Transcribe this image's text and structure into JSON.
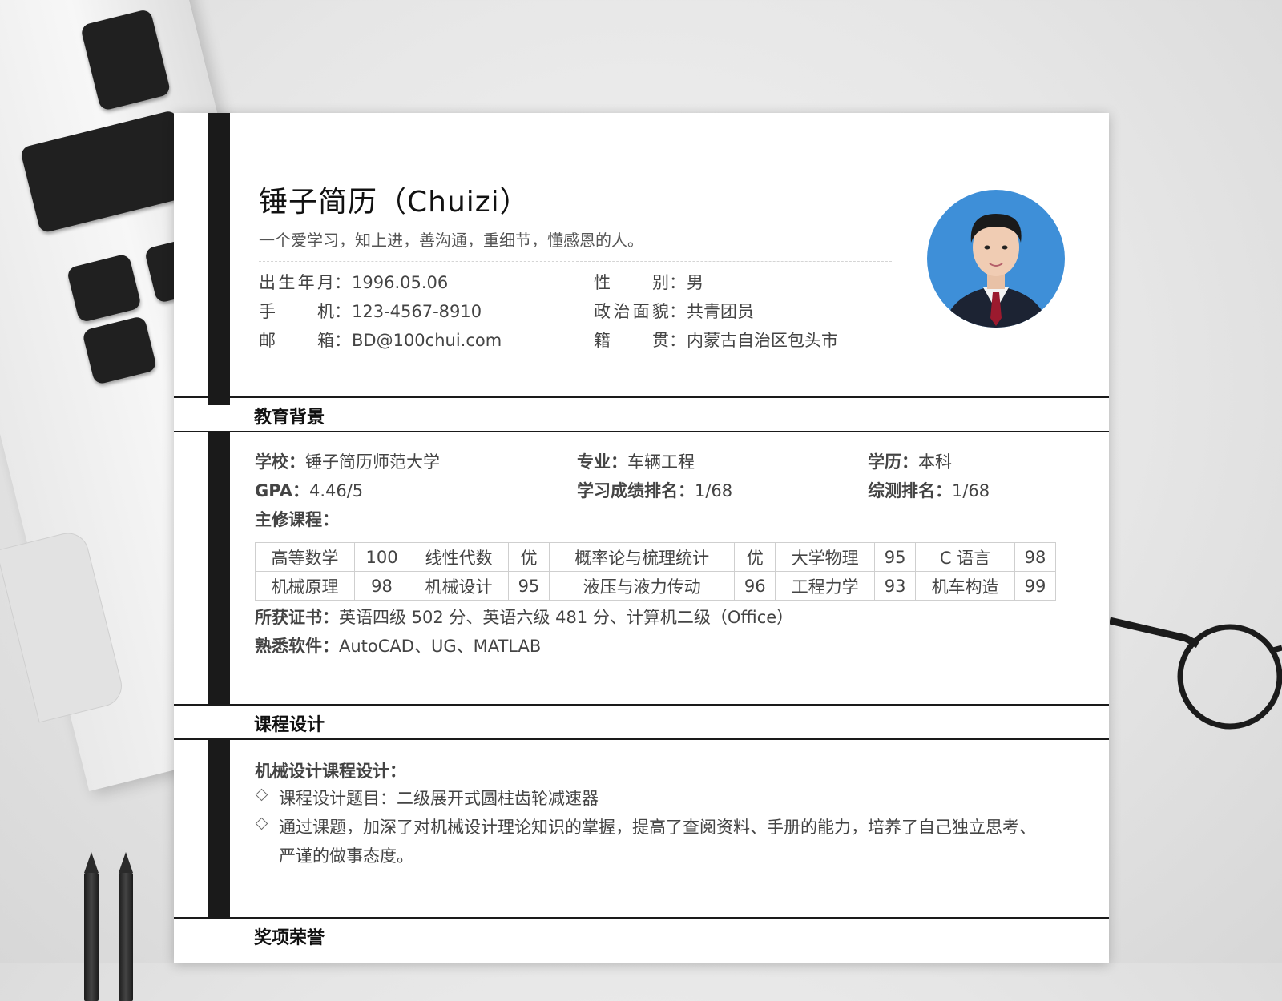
{
  "resume": {
    "name": "锤子简历（Chuizi）",
    "motto": "一个爱学习，知上进，善沟通，重细节，懂感恩的人。",
    "info": [
      {
        "key": "出生年月",
        "value": "1996.05.06"
      },
      {
        "key": "性别",
        "value": "男"
      },
      {
        "key": "手机",
        "value": "123-4567-8910"
      },
      {
        "key": "政治面貌",
        "value": "共青团员"
      },
      {
        "key": "邮箱",
        "value": "BD@100chui.com"
      },
      {
        "key": "籍贯",
        "value": "内蒙古自治区包头市"
      }
    ]
  },
  "education": {
    "title": "教育背景",
    "school_label": "学校：",
    "school": "锤子简历师范大学",
    "major_label": "专业：",
    "major": "车辆工程",
    "degree_label": "学历：",
    "degree": "本科",
    "gpa_label": "GPA：",
    "gpa": "4.46/5",
    "rank_label": "学习成绩排名：",
    "rank": "1/68",
    "overall_label": "综测排名：",
    "overall": "1/68",
    "courses_label": "主修课程：",
    "courses": [
      [
        "高等数学",
        "100",
        "线性代数",
        "优",
        "概率论与梳理统计",
        "优",
        "大学物理",
        "95",
        "C 语言",
        "98"
      ],
      [
        "机械原理",
        "98",
        "机械设计",
        "95",
        "液压与液力传动",
        "96",
        "工程力学",
        "93",
        "机车构造",
        "99"
      ]
    ],
    "cert_label": "所获证书：",
    "cert": "英语四级 502 分、英语六级 481 分、计算机二级（Office）",
    "software_label": "熟悉软件：",
    "software": "AutoCAD、UG、MATLAB"
  },
  "course_design": {
    "title": "课程设计",
    "heading": "机械设计课程设计：",
    "bullets": [
      "课程设计题目：二级展开式圆柱齿轮减速器",
      "通过课题，加深了对机械设计理论知识的掌握，提高了查阅资料、手册的能力，培养了自己独立思考、严谨的做事态度。"
    ]
  },
  "awards": {
    "title": "奖项荣誉"
  },
  "colors": {
    "accent_bar": "#1a1a1a",
    "photo_bg": "#3e8fd8",
    "text": "#444444"
  }
}
